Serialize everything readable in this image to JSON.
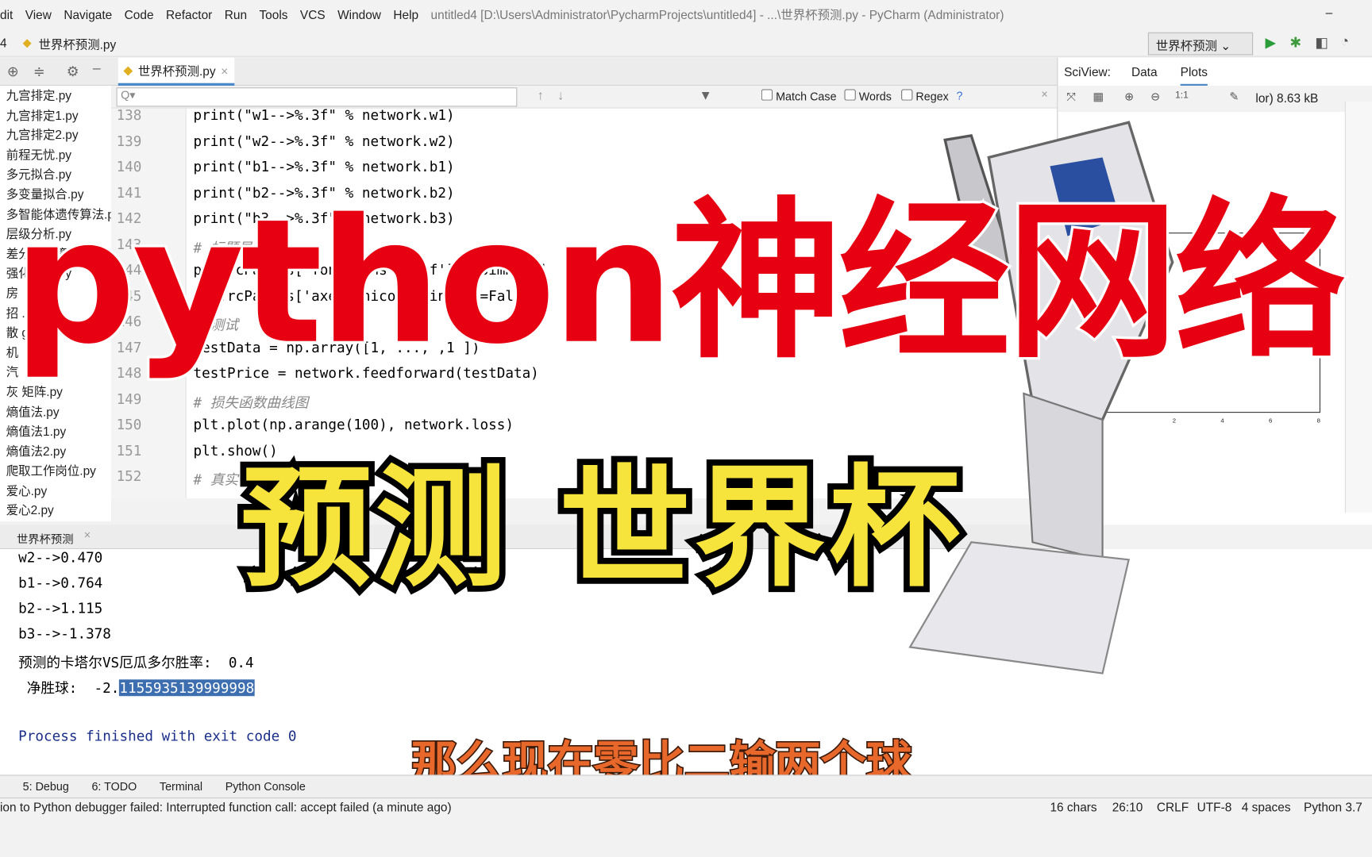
{
  "menu": [
    "dit",
    "View",
    "Navigate",
    "Code",
    "Refactor",
    "Run",
    "Tools",
    "VCS",
    "Window",
    "Help"
  ],
  "window_title": "untitled4 [D:\\Users\\Administrator\\PycharmProjects\\untitled4] - ...\\世界杯预测.py - PyCharm (Administrator)",
  "breadcrumb": {
    "project": "4",
    "file": "世界杯预测.py"
  },
  "run_config": "世界杯预测",
  "editor_tab": "世界杯预测.py",
  "search": {
    "placeholder": "Q▾",
    "match_case": "Match Case",
    "words": "Words",
    "regex": "Regex",
    "help": "?"
  },
  "tree": [
    "九宫排定.py",
    "九宫排定1.py",
    "九宫排定2.py",
    "前程无忧.py",
    "多元拟合.py",
    "多变量拟合.py",
    "多智能体遗传算法.py",
    "层级分析.py",
    "差分进化算法.py",
    "强化学习.py",
    "房",
    "招                .xlsx",
    "散                g",
    "机",
    "汽",
    "灰                矩阵.py",
    "熵值法.py",
    "熵值法1.py",
    "熵值法2.py",
    "爬取工作岗位.py",
    "爱心.py",
    "爱心2.py"
  ],
  "code": [
    {
      "n": "138",
      "t": "print(\"w1-->%.3f\" % network.w1)"
    },
    {
      "n": "139",
      "t": "print(\"w2-->%.3f\" % network.w2)"
    },
    {
      "n": "140",
      "t": "print(\"b1-->%.3f\" % network.b1)"
    },
    {
      "n": "141",
      "t": "print(\"b2-->%.3f\" % network.b2)"
    },
    {
      "n": "142",
      "t": "print(\"b3-->%.3f\" % network.b3)"
    },
    {
      "n": "143",
      "t": "# 标题显示中"
    },
    {
      "n": "144",
      "t": "plt.rcParams['font.sans-serif']=['SimHei']"
    },
    {
      "n": "145",
      "t": "plt.rcParams['axes.unicode_minus']=False"
    },
    {
      "n": "146",
      "t": "# 测试"
    },
    {
      "n": "147",
      "t": "testData = np.array([1, ..., ,1 ])"
    },
    {
      "n": "148",
      "t": "testPrice = network.feedforward(testData)"
    },
    {
      "n": "149",
      "t": "# 损失函数曲线图"
    },
    {
      "n": "150",
      "t": "plt.plot(np.arange(100), network.loss)"
    },
    {
      "n": "151",
      "t": "plt.show()"
    },
    {
      "n": "152",
      "t": "# 真实"
    }
  ],
  "run_tab": "世界杯预测",
  "console": [
    "w2-->0.470",
    "b1-->0.764",
    "b2-->1.115",
    "b3-->-1.378",
    "预测的卡塔尔VS厄瓜多尔胜率:  0.4"
  ],
  "net_goal": {
    "label": " 净胜球:  -2.",
    "selected": "1155935139999998"
  },
  "process_exit": "Process finished with exit code 0",
  "sciview": {
    "label": "SciView:",
    "tabs": [
      "Data",
      "Plots"
    ],
    "info": "lor) 8.63 kB",
    "plot_ticks": [
      "2",
      "4",
      "6",
      "8"
    ]
  },
  "bottom_tabs": [
    "5: Debug",
    "6: TODO",
    "Terminal",
    "Python Console"
  ],
  "status": {
    "message": "ion to Python debugger failed: Interrupted function call: accept failed (a minute ago)",
    "chars": "16 chars",
    "pos": "26:10",
    "eol": "CRLF",
    "enc": "UTF-8",
    "indent": "4 spaces",
    "interp": "Python 3.7"
  },
  "overlay": {
    "title": "python神经网络",
    "headline": "预测 世界杯",
    "subtitle": "那么现在零比二输两个球"
  },
  "colors": {
    "title_red": "#e60012",
    "headline_yellow": "#f6e33b",
    "subtitle_orange": "#e8672a",
    "selection": "#3d6fb0"
  }
}
